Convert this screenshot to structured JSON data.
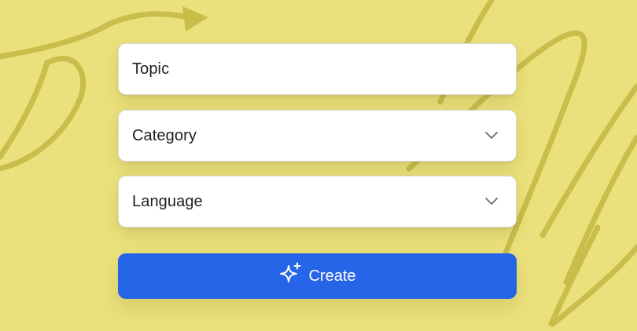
{
  "colors": {
    "background": "#ebe17c",
    "decoration": "#c9bd4c",
    "accent": "#2765e8",
    "field_bg": "#ffffff",
    "text": "#1f1f24",
    "chevron": "#6b6b75"
  },
  "form": {
    "topic": {
      "placeholder": "Topic"
    },
    "category": {
      "placeholder": "Category",
      "icon": "chevron-down-icon"
    },
    "language": {
      "placeholder": "Language",
      "icon": "chevron-down-icon"
    },
    "create_button": {
      "label": "Create",
      "icon": "sparkles-icon"
    }
  }
}
